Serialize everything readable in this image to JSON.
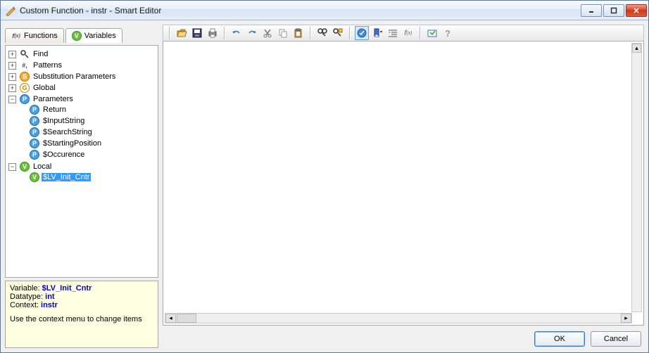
{
  "window": {
    "title": "Custom Function - instr - Smart Editor"
  },
  "tabs": {
    "functions": "Functions",
    "variables": "Variables"
  },
  "tree": {
    "find": "Find",
    "patterns": "Patterns",
    "subst": "Substitution Parameters",
    "global": "Global",
    "parameters": "Parameters",
    "p_return": "Return",
    "p_input": "$InputString",
    "p_search": "$SearchString",
    "p_start": "$StartingPosition",
    "p_occ": "$Occurence",
    "local": "Local",
    "local_var": "$LV_Init_Cntr"
  },
  "info": {
    "var_label": "Variable: ",
    "var_value": "$LV_Init_Cntr",
    "dt_label": "Datatype: ",
    "dt_value": "int",
    "ctx_label": "Context: ",
    "ctx_value": "instr",
    "hint": "Use the context menu to change items"
  },
  "buttons": {
    "ok": "OK",
    "cancel": "Cancel"
  },
  "toolbar": {
    "items": [
      "open",
      "save",
      "print",
      "",
      "undo",
      "redo",
      "cut",
      "copy",
      "paste",
      "",
      "find",
      "find-replace",
      "",
      "validate",
      "bookmark",
      "indent",
      "fn",
      "",
      "run",
      "help"
    ]
  }
}
